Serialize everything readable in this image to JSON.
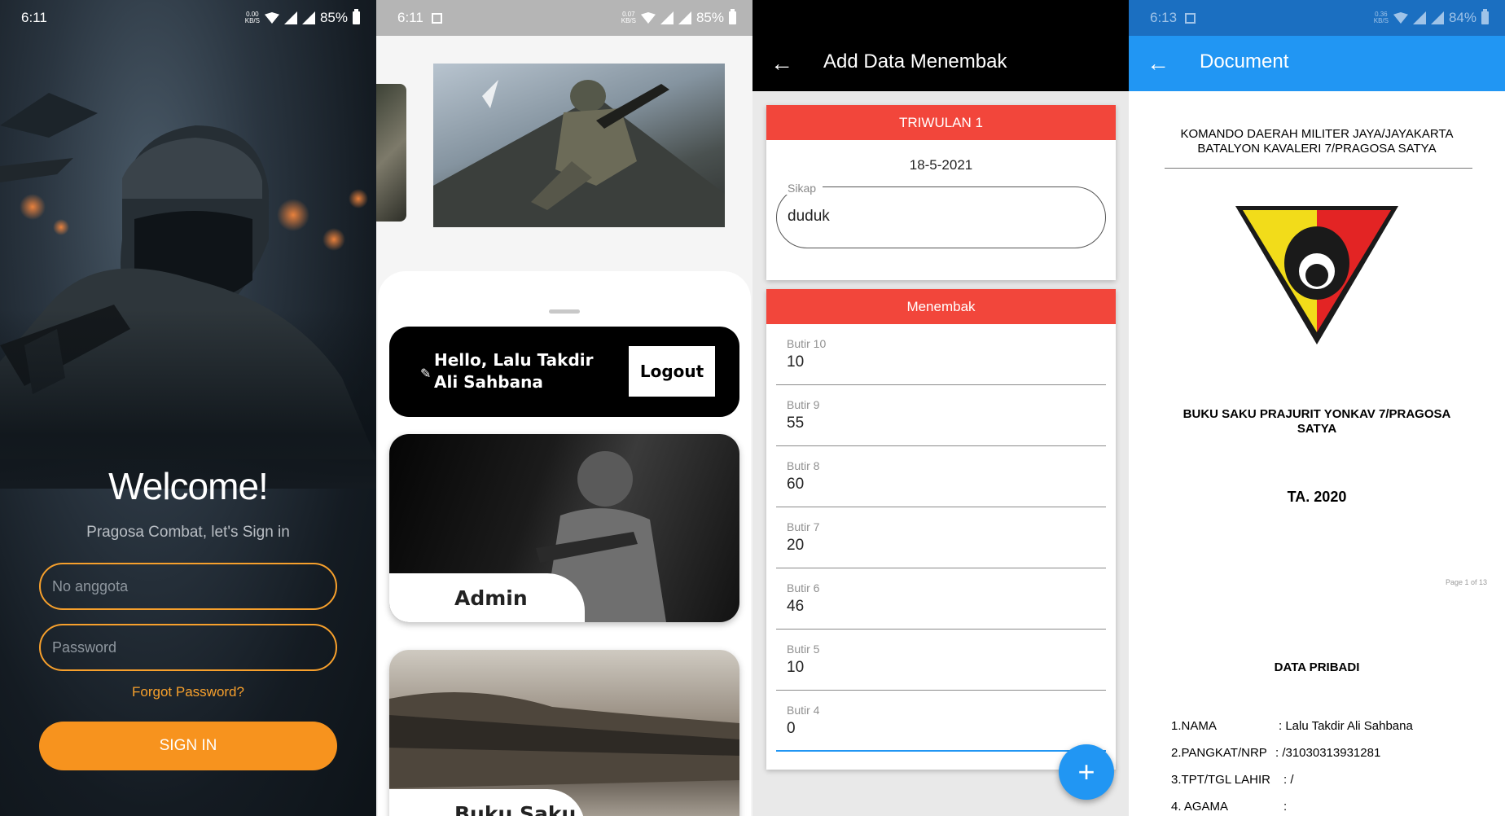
{
  "login": {
    "status": {
      "time": "6:11",
      "netspeed_top": "0.00",
      "netspeed_bottom": "KB/S",
      "battery": "85%"
    },
    "welcome": "Welcome!",
    "subtitle": "Pragosa Combat, let's Sign in",
    "member_placeholder": "No anggota",
    "password_placeholder": "Password",
    "forgot": "Forgot Password?",
    "signin": "SIGN IN",
    "accent": "#f7931e"
  },
  "home": {
    "status": {
      "time": "6:11",
      "netspeed_top": "0.07",
      "netspeed_bottom": "KB/S",
      "battery": "85%"
    },
    "greeting": "Hello, Lalu Takdir Ali Sahbana",
    "logout": "Logout",
    "cards": [
      {
        "label": "Admin"
      },
      {
        "label": "Buku Saku"
      }
    ]
  },
  "form": {
    "title": "Add Data Menembak",
    "section1": "TRIWULAN 1",
    "date": "18-5-2021",
    "sikap_label": "Sikap",
    "sikap_value": "duduk",
    "section2": "Menembak",
    "fields": [
      {
        "label": "Butir 10",
        "value": "10"
      },
      {
        "label": "Butir 9",
        "value": "55"
      },
      {
        "label": "Butir 8",
        "value": "60"
      },
      {
        "label": "Butir 7",
        "value": "20"
      },
      {
        "label": "Butir 6",
        "value": "46"
      },
      {
        "label": "Butir 5",
        "value": "10"
      },
      {
        "label": "Butir 4",
        "value": "0"
      }
    ],
    "header_color": "#f2463b",
    "fab_color": "#2196f3"
  },
  "document": {
    "status": {
      "time": "6:13",
      "netspeed_top": "0.36",
      "netspeed_bottom": "KB/S",
      "battery": "84%"
    },
    "title": "Document",
    "header_line1": "KOMANDO DAERAH MILITER JAYA/JAYAKARTA",
    "header_line2": "BATALYON KAVALERI 7/PRAGOSA SATYA",
    "book_title_line1": "BUKU SAKU PRAJURIT YONKAV 7/PRAGOSA",
    "book_title_line2": "SATYA",
    "year": "TA. 2020",
    "page": "Page 1 of 13",
    "section": "DATA PRIBADI",
    "rows": [
      {
        "label": "1.NAMA",
        "value": ": Lalu Takdir Ali Sahbana"
      },
      {
        "label": "2.PANGKAT/NRP",
        "value": ": /31030313931281"
      },
      {
        "label": "3.TPT/TGL LAHIR",
        "value": ": /"
      },
      {
        "label": "4. AGAMA",
        "value": ":"
      }
    ]
  }
}
